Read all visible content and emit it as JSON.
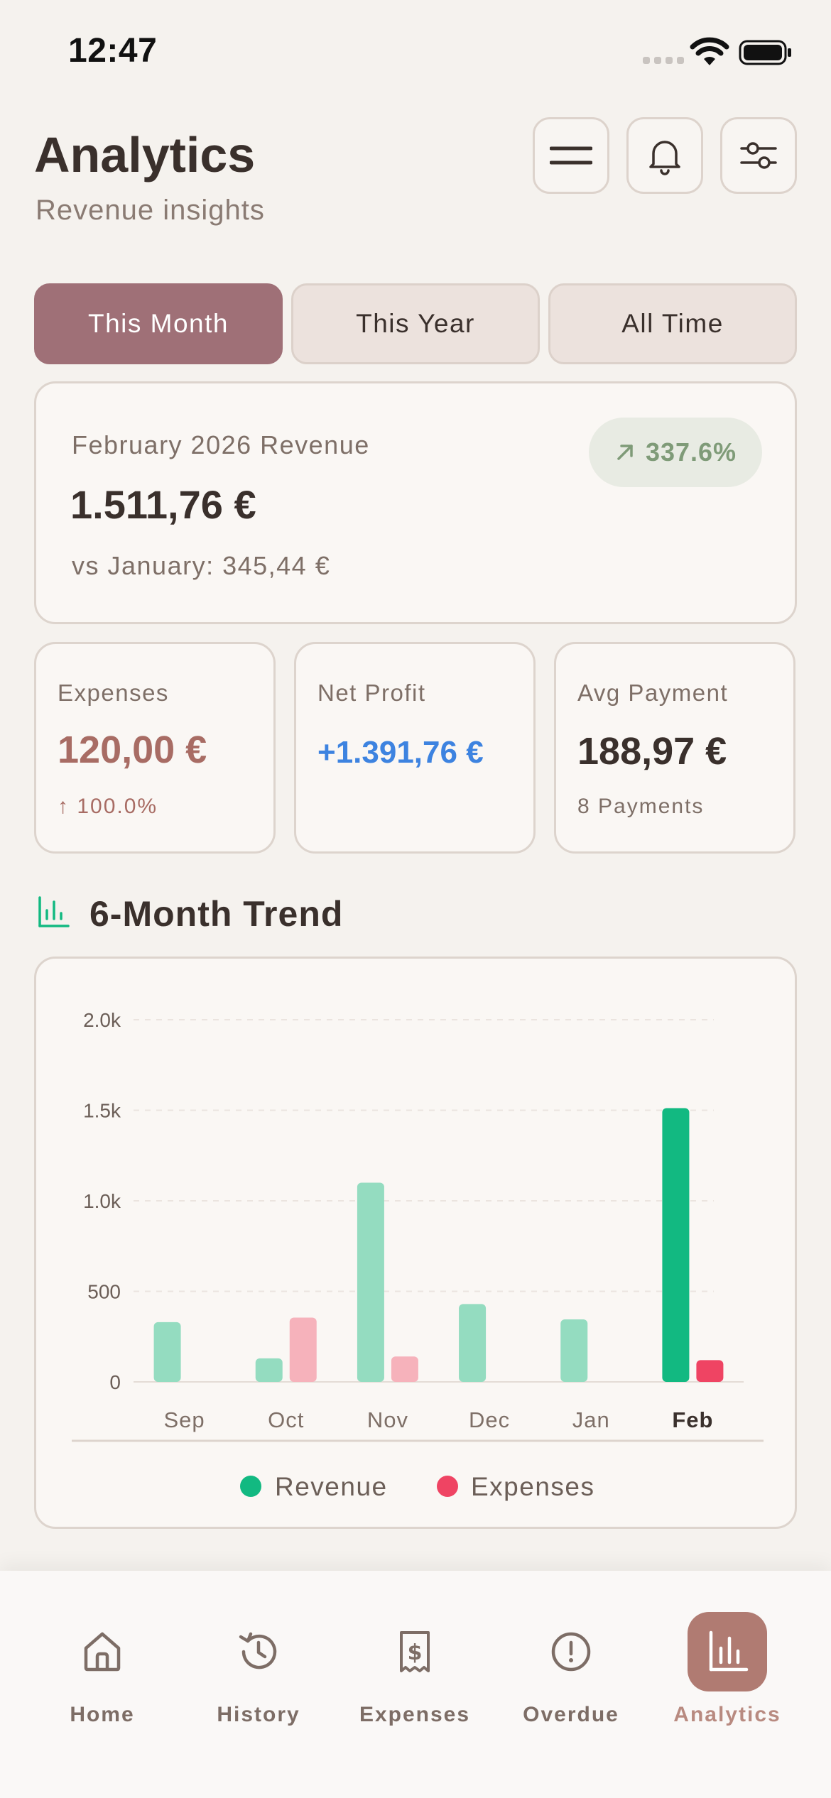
{
  "status_bar": {
    "time": "12:47"
  },
  "header": {
    "title": "Analytics",
    "subtitle": "Revenue insights",
    "buttons": {
      "menu": "menu-icon",
      "notifications": "bell-icon",
      "filters": "sliders-icon"
    }
  },
  "tabs": [
    {
      "label": "This Month",
      "active": true
    },
    {
      "label": "This Year",
      "active": false
    },
    {
      "label": "All Time",
      "active": false
    }
  ],
  "revenue_card": {
    "label": "February 2026 Revenue",
    "value": "1.511,76 €",
    "comparison": "vs January: 345,44 €",
    "change": "337.6%"
  },
  "stats": {
    "expenses": {
      "label": "Expenses",
      "value": "120,00 €",
      "change": "100.0%"
    },
    "net_profit": {
      "label": "Net Profit",
      "value": "+1.391,76 €"
    },
    "avg_payment": {
      "label": "Avg Payment",
      "value": "188,97 €",
      "sub": "8 Payments"
    }
  },
  "trend": {
    "title": "6-Month Trend"
  },
  "colors": {
    "accent": "#9f7077",
    "revenue": "#12b981",
    "revenue_faded": "#94dcc0",
    "expenses": "#ef4463",
    "expenses_faded": "#f6b2bb",
    "net_profit": "#3d83e0",
    "expense_text": "#a86c64"
  },
  "chart_data": {
    "type": "bar",
    "categories": [
      "Sep",
      "Oct",
      "Nov",
      "Dec",
      "Jan",
      "Feb"
    ],
    "highlight_category": "Feb",
    "series": [
      {
        "name": "Revenue",
        "values": [
          330,
          130,
          1100,
          430,
          345,
          1512
        ]
      },
      {
        "name": "Expenses",
        "values": [
          0,
          355,
          140,
          0,
          0,
          120
        ]
      }
    ],
    "ylim": [
      0,
      2000
    ],
    "yticks": [
      0,
      500,
      1000,
      1500,
      2000
    ],
    "ytick_labels": [
      "0",
      "500",
      "1.0k",
      "1.5k",
      "2.0k"
    ],
    "grid": true,
    "legend": "bottom-center"
  },
  "nav": [
    {
      "label": "Home",
      "icon": "home-icon",
      "active": false
    },
    {
      "label": "History",
      "icon": "history-icon",
      "active": false
    },
    {
      "label": "Expenses",
      "icon": "receipt-icon",
      "active": false
    },
    {
      "label": "Overdue",
      "icon": "alert-circle-icon",
      "active": false
    },
    {
      "label": "Analytics",
      "icon": "bar-chart-icon",
      "active": true
    }
  ]
}
